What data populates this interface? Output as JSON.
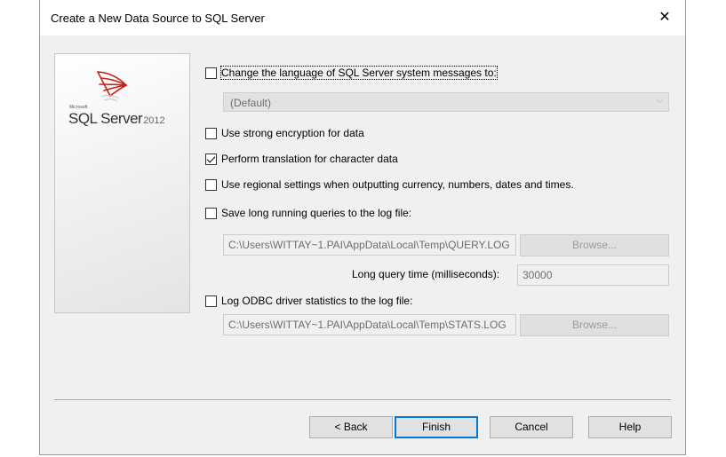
{
  "window": {
    "title": "Create a New Data Source to SQL Server",
    "close_glyph": "✕"
  },
  "logo": {
    "microsoft": "Microsoft",
    "product": "SQL Server",
    "version": "2012"
  },
  "options": {
    "change_language": {
      "label": "Change the language of SQL Server system messages to:",
      "checked": false
    },
    "language_select": {
      "value": "(Default)",
      "enabled": false
    },
    "strong_encryption": {
      "label": "Use strong encryption for data",
      "checked": false
    },
    "translation": {
      "label": "Perform translation for character data",
      "checked": true
    },
    "regional": {
      "label": "Use regional settings when outputting currency, numbers, dates and times.",
      "checked": false
    },
    "long_queries": {
      "label": "Save long running queries to the log file:",
      "checked": false
    },
    "long_queries_path": "C:\\Users\\WITTAY~1.PAI\\AppData\\Local\\Temp\\QUERY.LOG",
    "browse1": "Browse...",
    "long_query_time_label": "Long query time (milliseconds):",
    "long_query_time_value": "30000",
    "odbc_stats": {
      "label": "Log ODBC driver statistics to the log file:",
      "checked": false
    },
    "odbc_stats_path": "C:\\Users\\WITTAY~1.PAI\\AppData\\Local\\Temp\\STATS.LOG",
    "browse2": "Browse..."
  },
  "buttons": {
    "back": "< Back",
    "finish": "Finish",
    "cancel": "Cancel",
    "help": "Help"
  },
  "icons": {
    "close": "close-icon",
    "dropdown": "chevron-down-icon",
    "logo": "sql-server-logo-icon"
  },
  "colors": {
    "default_button_border": "#0078d7",
    "logo_red": "#c8201a"
  }
}
